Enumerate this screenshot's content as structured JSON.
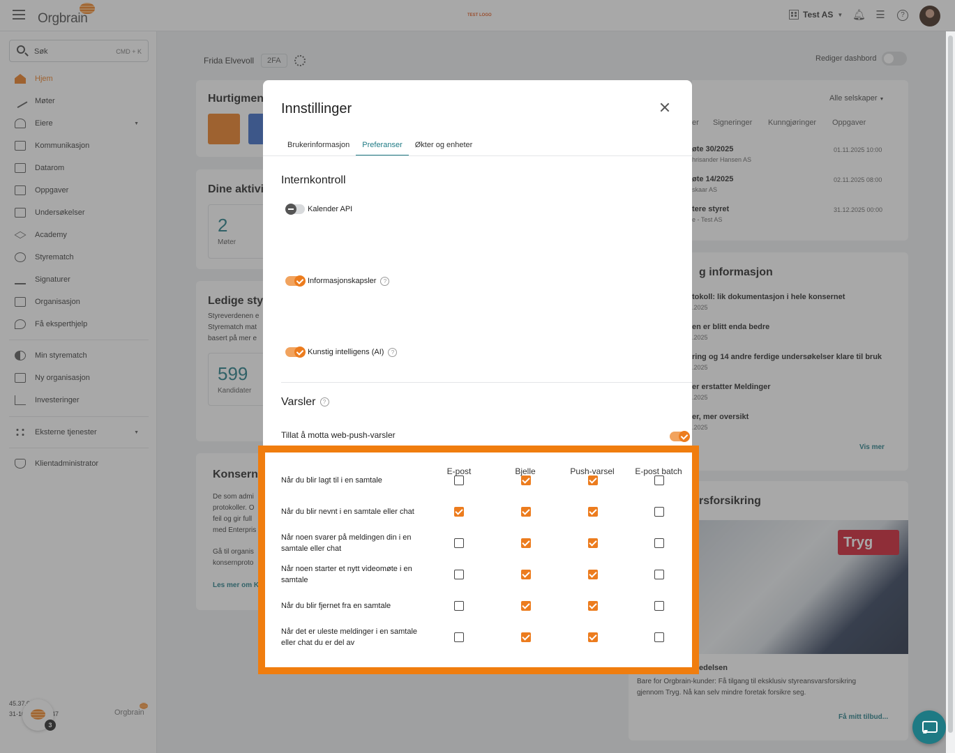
{
  "topbar": {
    "app_name": "Orgbrain",
    "env_label": "TEST LOGO",
    "company": "Test AS"
  },
  "sidebar": {
    "search_placeholder": "Søk",
    "search_shortcut": "CMD + K",
    "items": [
      {
        "label": "Hjem",
        "icon": "home-icon"
      },
      {
        "label": "Møter",
        "icon": "gavel-icon"
      },
      {
        "label": "Eiere",
        "icon": "owners-icon"
      },
      {
        "label": "Kommunikasjon",
        "icon": "chat-icon"
      },
      {
        "label": "Datarom",
        "icon": "folder-icon"
      },
      {
        "label": "Oppgaver",
        "icon": "task-icon"
      },
      {
        "label": "Undersøkelser",
        "icon": "survey-icon"
      },
      {
        "label": "Academy",
        "icon": "academy-icon"
      },
      {
        "label": "Styrematch",
        "icon": "styrematch-icon"
      },
      {
        "label": "Signaturer",
        "icon": "signature-icon"
      },
      {
        "label": "Organisasjon",
        "icon": "organization-icon"
      },
      {
        "label": "Få eksperthjelp",
        "icon": "expert-icon"
      },
      {
        "label": "Min styrematch",
        "icon": "my-styrematch-icon"
      },
      {
        "label": "Ny organisasjon",
        "icon": "new-organization-icon"
      },
      {
        "label": "Investeringer",
        "icon": "investments-icon"
      },
      {
        "label": "Eksterne tjenester",
        "icon": "external-services-icon"
      },
      {
        "label": "Klientadministrator",
        "icon": "client-admin-icon"
      }
    ],
    "version": "45.37.0",
    "build_date": "31-10-2025 10:47",
    "footer_logo": "Orgbrain",
    "assistant_badge": "3"
  },
  "background": {
    "user_name": "Frida Elvevoll",
    "twofa": "2FA",
    "edit_dashboard": "Rediger dashbord",
    "quickmenu_title": "Hurtigmeny",
    "activities_title": "Dine aktivit",
    "meetings_count": "2",
    "meetings_label": "Møter",
    "vacant_title": "Ledige styr",
    "vacant_text": [
      "Styreverdenen e",
      "Styrematch mat",
      "basert på mer e"
    ],
    "candidates_count": "599",
    "candidates_label": "Kandidater",
    "group_title": "Konsernp",
    "group_text": [
      "De som admi",
      "protokoller. O",
      "feil og gir full",
      "med Enterpris"
    ],
    "group_text2": [
      "Gå til organis",
      "konsernproto"
    ],
    "group_link": "Les mer om K",
    "all_companies": "Alle selskaper",
    "right_tabs": [
      "er",
      "Signeringer",
      "Kunngjøringer",
      "Oppgaver"
    ],
    "events": [
      {
        "title": "øte 30/2025",
        "sub": "hrisander Hansen AS",
        "date": "01.11.2025 10:00"
      },
      {
        "title": "øte 14/2025",
        "sub": "skaar AS",
        "date": "02.11.2025 08:00"
      },
      {
        "title": "tere styret",
        "sub": "e - Test AS",
        "date": "31.12.2025 00:00"
      }
    ],
    "news_title": "g informasjon",
    "news": [
      {
        "title": "tokoll: lik dokumentasjon i hele konsernet",
        "date": ".2025"
      },
      {
        "title": "en er blitt enda bedre",
        "date": ".2025"
      },
      {
        "title": "ring og 14 andre ferdige undersøkelser klare til bruk",
        "date": ".2025"
      },
      {
        "title": "er erstatter Meldinger",
        "date": ".2025"
      },
      {
        "title": "er, mer oversikt",
        "date": ".2025"
      }
    ],
    "news_link": "Vis mer",
    "insurance_title": "rsforsikring",
    "insurance_brand": "Tryg",
    "insurance_sub": "edelsen",
    "insurance_text": [
      "Bare for Orgbrain-kunder: Få tilgang til eksklusiv styreansvarsforsikring",
      "gjennom Tryg. Nå kan selv mindre foretak forsikre seg."
    ],
    "insurance_link": "Få mitt tilbud..."
  },
  "modal": {
    "title": "Innstillinger",
    "tabs": [
      "Brukerinformasjon",
      "Preferanser",
      "Økter og enheter"
    ],
    "active_tab": "Preferanser",
    "internal_control_title": "Internkontroll",
    "toggles": [
      {
        "label": "Kalender API",
        "on": false
      },
      {
        "label": "Informasjonskapsler",
        "on": true
      },
      {
        "label": "Kunstig intelligens (AI)",
        "on": true
      }
    ],
    "notifications_title": "Varsler",
    "web_push_label": "Tillat å motta web-push-varsler",
    "web_push_on": true,
    "columns": [
      "E-post",
      "Bjelle",
      "Push-varsel",
      "E-post batch"
    ],
    "rows": [
      {
        "label": "Når du blir lagt til i en samtale",
        "values": [
          false,
          true,
          true,
          false
        ]
      },
      {
        "label": "Når du blir nevnt i en samtale eller chat",
        "values": [
          true,
          true,
          true,
          false
        ]
      },
      {
        "label": "Når noen svarer på meldingen din i en samtale eller chat",
        "values": [
          false,
          true,
          true,
          false
        ]
      },
      {
        "label": "Når noen starter et nytt videomøte i en samtale",
        "values": [
          false,
          true,
          true,
          false
        ]
      },
      {
        "label": "Når du blir fjernet fra en samtale",
        "values": [
          false,
          true,
          true,
          false
        ]
      },
      {
        "label": "Når det er uleste meldinger i en samtale eller chat du er del av",
        "values": [
          false,
          true,
          true,
          false
        ]
      }
    ]
  },
  "colors": {
    "accent": "#ec7c1e",
    "teal": "#1e7a84",
    "highlight": "#f07d0e"
  }
}
